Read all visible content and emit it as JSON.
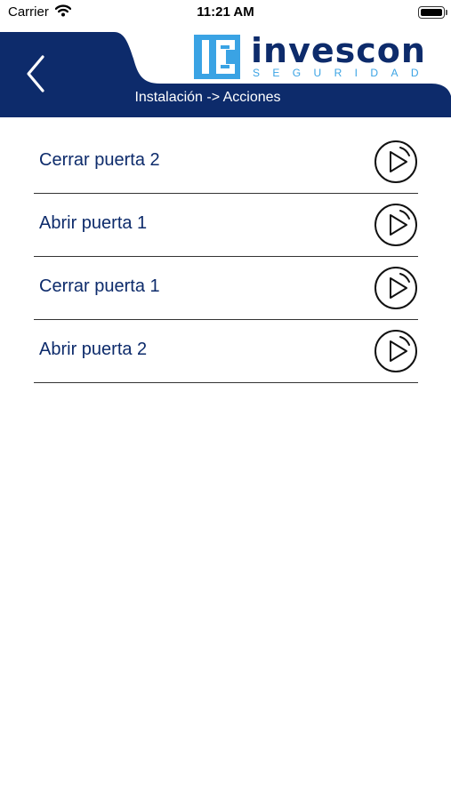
{
  "status_bar": {
    "carrier": "Carrier",
    "time": "11:21 AM"
  },
  "header": {
    "brand_name": "invescon",
    "brand_tagline": "SEGURIDAD",
    "breadcrumb": "Instalación -> Acciones",
    "colors": {
      "navy": "#0d2b6b",
      "light_blue": "#3aa3e4"
    }
  },
  "actions": [
    {
      "label": "Cerrar puerta 2",
      "icon": "play-icon"
    },
    {
      "label": "Abrir puerta 1",
      "icon": "play-icon"
    },
    {
      "label": "Cerrar puerta 1",
      "icon": "play-icon"
    },
    {
      "label": "Abrir puerta 2",
      "icon": "play-icon"
    }
  ]
}
